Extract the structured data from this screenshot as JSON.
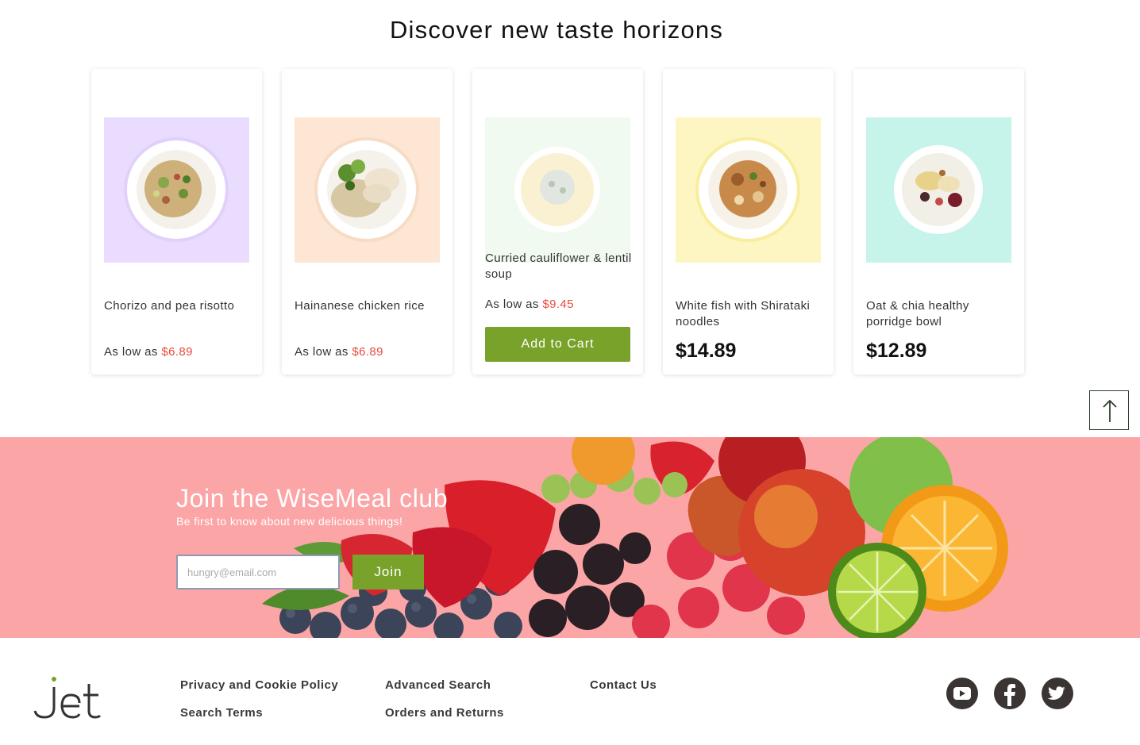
{
  "section": {
    "title": "Discover new taste horizons"
  },
  "products": [
    {
      "name": "Chorizo and pea risotto",
      "price_prefix": "As low as",
      "price": "$6.89",
      "bg": "#e9dcff"
    },
    {
      "name": "Hainanese chicken rice",
      "price_prefix": "As low as",
      "price": "$6.89",
      "bg": "#fde6d3"
    },
    {
      "name": "Curried cauliflower & lentil soup",
      "price_prefix": "As low as",
      "price": "$9.45",
      "bg": "#e6f7e4",
      "button": "Add to Cart"
    },
    {
      "name": "White fish with Shirataki noodles",
      "big_price": "$14.89",
      "bg": "#fdf6c2"
    },
    {
      "name": "Oat & chia healthy porridge bowl",
      "big_price": "$12.89",
      "bg": "#c6f3ea"
    }
  ],
  "newsletter": {
    "title": "Join the WiseMeal club",
    "subtitle": "Be first to know about new delicious things!",
    "email_placeholder": "hungry@email.com",
    "button": "Join",
    "bg": "#fca5a7"
  },
  "footer": {
    "logo": "jet",
    "links": [
      "Privacy and Cookie Policy",
      "Search Terms",
      "Advanced Search",
      "Orders and Returns",
      "Contact Us"
    ],
    "social_icons": [
      "youtube-icon",
      "facebook-icon",
      "twitter-icon"
    ]
  },
  "colors": {
    "accent_green": "#79a22b",
    "price_red": "#e84b3c",
    "icon_dark": "#3a3433"
  },
  "scroll_top_icon": "arrow-up-icon"
}
